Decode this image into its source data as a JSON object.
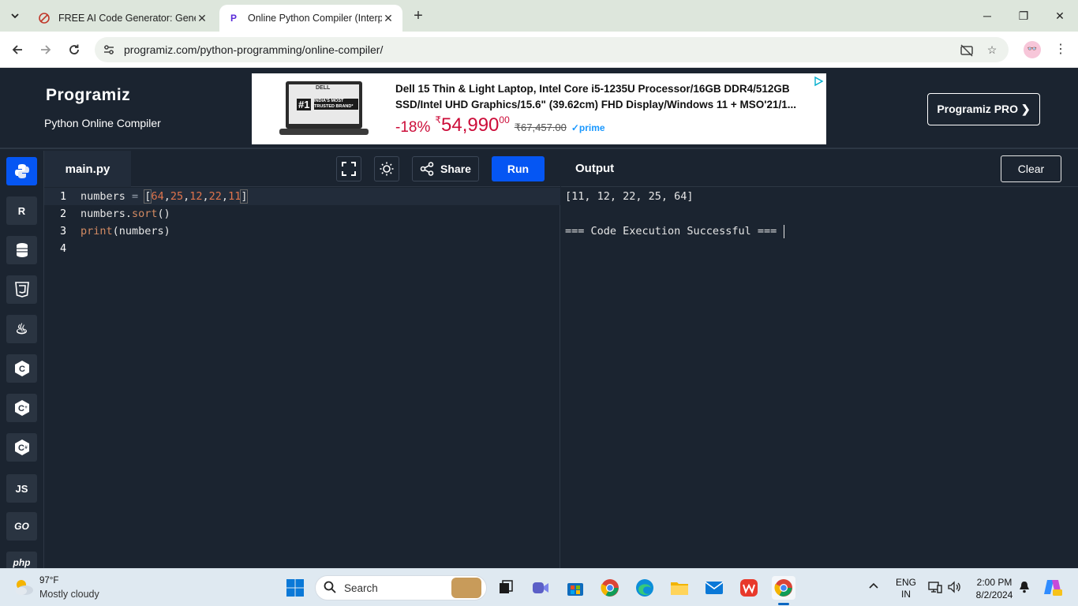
{
  "browser": {
    "tabs": [
      {
        "title": "FREE AI Code Generator: Generate",
        "favicon": "no-entry-icon"
      },
      {
        "title": "Online Python Compiler (Interpreter)",
        "favicon": "programiz-icon"
      }
    ],
    "new_tab": "+",
    "url": "programiz.com/python-programming/online-compiler/",
    "window_controls": {
      "minimize": "─",
      "restore": "❐",
      "close": "✕"
    }
  },
  "site": {
    "logo": "Programiz",
    "subtitle": "Python Online Compiler",
    "pro_button": "Programiz PRO ❯",
    "ad": {
      "title": "Dell 15 Thin & Light Laptop, Intel Core i5-1235U Processor/16GB DDR4/512GB SSD/Intel UHD Graphics/15.6\" (39.62cm) FHD Display/Windows 11 + MSO'21/1...",
      "discount": "-18%",
      "currency": "₹",
      "price": "54,990",
      "price_fraction": "00",
      "mrp": "₹67,457.00",
      "prime": "✓prime",
      "badge_brand": "DELL",
      "badge_rank": "#1",
      "badge_text": "INDIA'S MOST TRUSTED BRAND*"
    }
  },
  "rail": {
    "items": [
      {
        "name": "python",
        "label": "Py"
      },
      {
        "name": "r",
        "label": "R"
      },
      {
        "name": "sql",
        "label": "≡"
      },
      {
        "name": "html",
        "label": "5"
      },
      {
        "name": "java",
        "label": "♨"
      },
      {
        "name": "c",
        "label": "C"
      },
      {
        "name": "cpp",
        "label": "C"
      },
      {
        "name": "csharp",
        "label": "C"
      },
      {
        "name": "js",
        "label": "JS"
      },
      {
        "name": "go",
        "label": "GO"
      },
      {
        "name": "php",
        "label": "php"
      }
    ]
  },
  "editor": {
    "file_name": "main.py",
    "share_label": "Share",
    "run_label": "Run",
    "lines": [
      {
        "n": "1"
      },
      {
        "n": "2"
      },
      {
        "n": "3"
      },
      {
        "n": "4"
      }
    ],
    "code": {
      "l1_var": "numbers ",
      "l1_eq": "= ",
      "l1_open": "[",
      "l1_nums": [
        "64",
        "25",
        "12",
        "22",
        "11"
      ],
      "l1_comma": ",",
      "l1_close": "]",
      "l2_obj": "numbers.",
      "l2_fn": "sort",
      "l2_rest": "()",
      "l3_fn": "print",
      "l3_rest": "(numbers)"
    }
  },
  "output": {
    "title": "Output",
    "clear_label": "Clear",
    "lines": [
      "[11, 12, 22, 25, 64]",
      "=== Code Execution Successful ==="
    ]
  },
  "taskbar": {
    "temperature": "97°F",
    "weather": "Mostly cloudy",
    "search_label": "Search",
    "language": "ENG",
    "region": "IN",
    "time": "2:00 PM",
    "date": "8/2/2024"
  },
  "colors": {
    "page_bg": "#1b2430",
    "accent": "#0556f3",
    "number_token": "#e0744c"
  }
}
